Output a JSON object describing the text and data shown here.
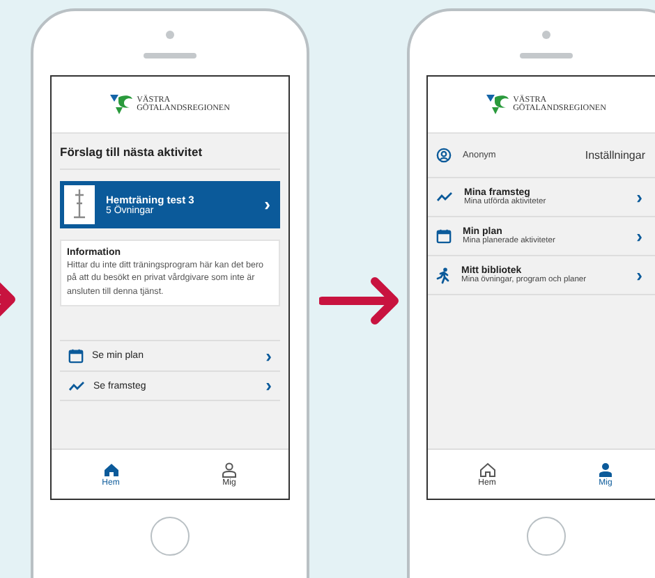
{
  "screens": [
    {
      "kind": "home",
      "logo": {
        "line1": "VÄSTRA",
        "line2": "GÖTALANDSREGIONEN"
      },
      "title": "Förslag till nästa aktivitet",
      "suggestion": {
        "title": "Hemträning test 3",
        "subtitle": "5 Övningar",
        "chevron": "›"
      },
      "info": {
        "heading": "Information",
        "body": "Hittar du inte ditt träningsprogram här kan det bero på att du besökt en privat vårdgivare som inte är ansluten till denna tjänst."
      },
      "links": [
        {
          "kind": "calendar",
          "label": "Se min plan",
          "chevron": "›"
        },
        {
          "kind": "chart",
          "label": "Se framsteg",
          "chevron": "›"
        }
      ],
      "tabs": [
        {
          "kind": "home",
          "label": "Hem",
          "selected": true
        },
        {
          "kind": "person",
          "label": "Mig",
          "selected": false
        }
      ]
    },
    {
      "kind": "profile",
      "logo": {
        "line1": "VÄSTRA",
        "line2": "GÖTALANDSREGIONEN"
      },
      "profile": {
        "name": "Anonym",
        "settings": "Inställningar"
      },
      "menu": [
        {
          "kind": "chart",
          "title": "Mina framsteg",
          "subtitle": "Mina utförda aktiviteter",
          "chevron": "›"
        },
        {
          "kind": "calendar",
          "title": "Min plan",
          "subtitle": "Mina planerade aktiviteter",
          "chevron": "›"
        },
        {
          "kind": "runner",
          "title": "Mitt bibliotek",
          "subtitle": "Mina övningar, program och planer",
          "chevron": "›"
        }
      ],
      "tabs": [
        {
          "kind": "home",
          "label": "Hem",
          "selected": false
        },
        {
          "kind": "person",
          "label": "Mig",
          "selected": true
        }
      ]
    }
  ]
}
